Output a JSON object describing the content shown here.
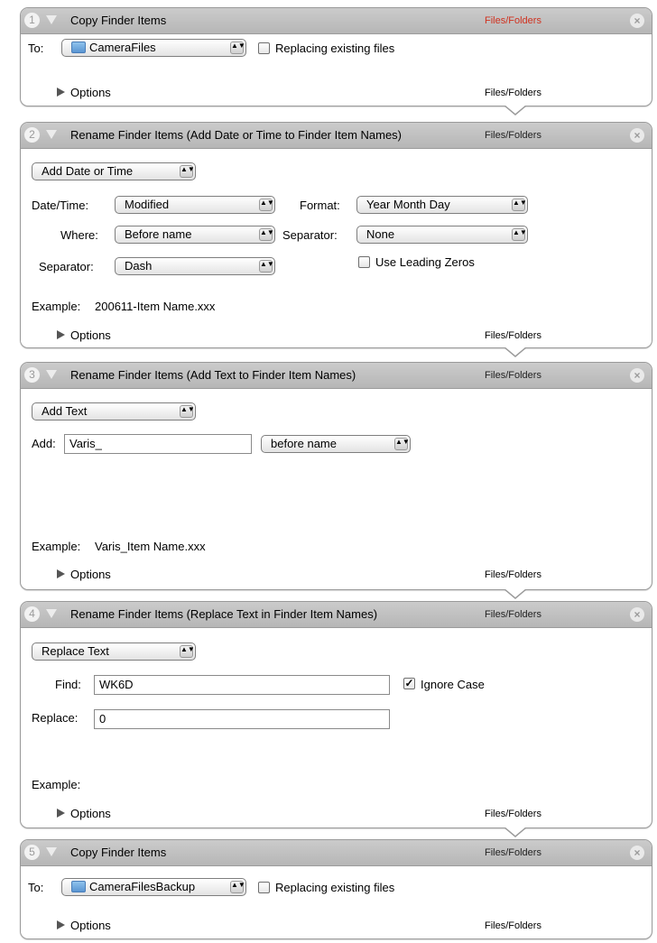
{
  "actions": [
    {
      "num": "1",
      "title": "Copy Finder Items",
      "category": "Files/Folders",
      "category_color": "#d0311f",
      "to_label": "To:",
      "to_value": "CameraFiles",
      "replacing_label": "Replacing existing files",
      "replacing_checked": false,
      "options_label": "Options",
      "footer_category": "Files/Folders"
    },
    {
      "num": "2",
      "title": "Rename Finder Items (Add Date or Time to Finder Item Names)",
      "category": "Files/Folders",
      "mode_value": "Add Date or Time",
      "datetime_label": "Date/Time:",
      "datetime_value": "Modified",
      "format_label": "Format:",
      "format_value": "Year Month Day",
      "where_label": "Where:",
      "where_value": "Before name",
      "separator1_label": "Separator:",
      "separator1_value": "None",
      "separator2_label": "Separator:",
      "separator2_value": "Dash",
      "leading_zeros_label": "Use Leading Zeros",
      "leading_zeros_checked": false,
      "example_label": "Example:",
      "example_value": "200611-Item Name.xxx",
      "options_label": "Options",
      "footer_category": "Files/Folders"
    },
    {
      "num": "3",
      "title": "Rename Finder Items (Add Text to Finder Item Names)",
      "category": "Files/Folders",
      "mode_value": "Add Text",
      "add_label": "Add:",
      "add_value": "Varis_",
      "position_value": "before name",
      "example_label": "Example:",
      "example_value": "Varis_Item Name.xxx",
      "options_label": "Options",
      "footer_category": "Files/Folders"
    },
    {
      "num": "4",
      "title": "Rename Finder Items (Replace Text in Finder Item Names)",
      "category": "Files/Folders",
      "mode_value": "Replace Text",
      "find_label": "Find:",
      "find_value": "WK6D",
      "ignore_case_label": "Ignore Case",
      "ignore_case_checked": true,
      "replace_label": "Replace:",
      "replace_value": "0",
      "example_label": "Example:",
      "example_value": "",
      "options_label": "Options",
      "footer_category": "Files/Folders"
    },
    {
      "num": "5",
      "title": "Copy Finder Items",
      "category": "Files/Folders",
      "to_label": "To:",
      "to_value": "CameraFilesBackup",
      "replacing_label": "Replacing existing files",
      "replacing_checked": false,
      "options_label": "Options",
      "footer_category": "Files/Folders"
    }
  ],
  "icons": {
    "collapse": "disclosure-triangle-down-icon",
    "close": "close-circle-icon",
    "options": "disclosure-triangle-right-icon",
    "folder": "folder-icon",
    "popup": "popup-arrows-icon"
  },
  "glyphs": {
    "close": "×",
    "popup_arrows": "▲▼",
    "check": "✓"
  }
}
